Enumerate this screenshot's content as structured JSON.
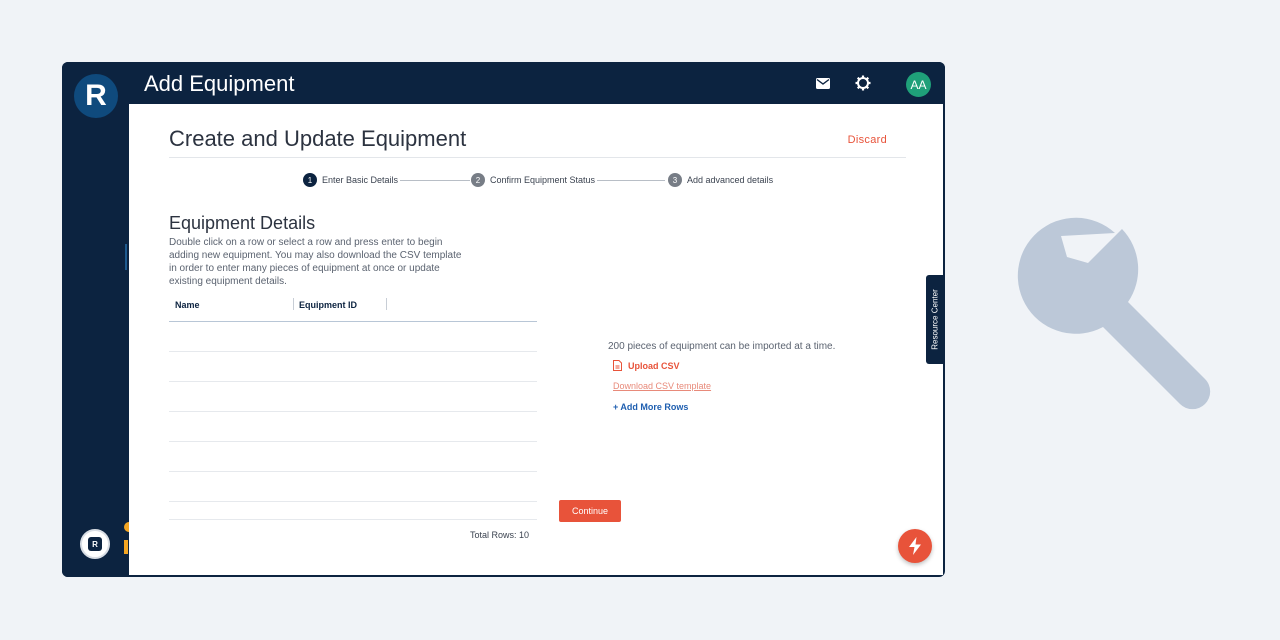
{
  "app": {
    "logo_letter": "R",
    "title": "Add Equipment",
    "user_initials": "AA",
    "mascot_letter": "R"
  },
  "header_icons": [
    "mail-icon",
    "gear-icon"
  ],
  "page": {
    "title": "Create and Update Equipment",
    "discard_label": "Discard"
  },
  "stepper": {
    "steps": [
      {
        "num": "1",
        "label": "Enter Basic Details",
        "active": true
      },
      {
        "num": "2",
        "label": "Confirm Equipment Status",
        "active": false
      },
      {
        "num": "3",
        "label": "Add advanced details",
        "active": false
      }
    ]
  },
  "section": {
    "title": "Equipment Details",
    "description": "Double click on a row or select a row and press enter to begin adding new equipment. You may also download the CSV template in order to enter many pieces of equipment at once or update existing equipment details."
  },
  "table": {
    "columns": [
      "Name",
      "Equipment ID"
    ],
    "total_rows": "Total Rows: 10"
  },
  "import": {
    "info": "200 pieces of equipment can be imported at a time.",
    "upload_label": "Upload CSV",
    "download_label": "Download CSV template",
    "add_rows_label": "+ Add More Rows"
  },
  "actions": {
    "continue_label": "Continue"
  },
  "resource_center": "Resource Center",
  "colors": {
    "navy": "#0c2340",
    "accent": "#e8533a",
    "avatar": "#1fa079",
    "link_blue": "#1f5fb0",
    "wrench": "#bcc8d8"
  }
}
